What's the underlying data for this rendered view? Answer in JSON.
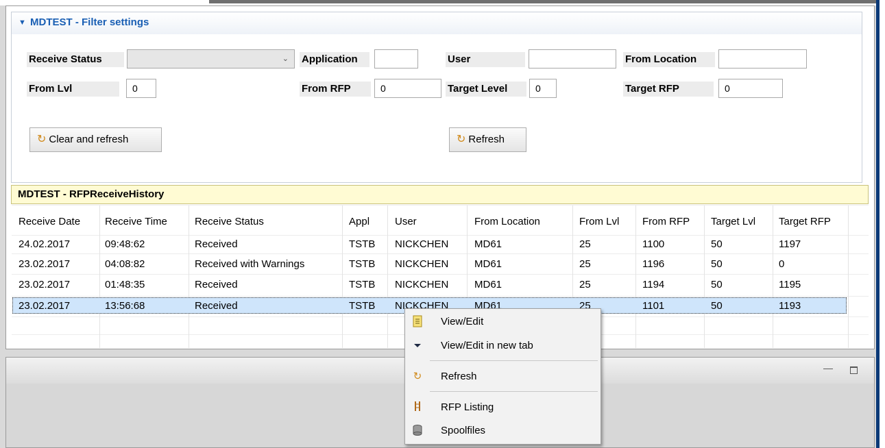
{
  "filter": {
    "title": "MDTEST - Filter settings",
    "fields": {
      "receive_status": {
        "label": "Receive Status",
        "value": ""
      },
      "application": {
        "label": "Application",
        "value": ""
      },
      "user": {
        "label": "User",
        "value": ""
      },
      "from_location": {
        "label": "From Location",
        "value": ""
      },
      "from_lvl": {
        "label": "From Lvl",
        "value": "0"
      },
      "from_rfp": {
        "label": "From RFP",
        "value": "0"
      },
      "target_level": {
        "label": "Target Level",
        "value": "0"
      },
      "target_rfp": {
        "label": "Target RFP",
        "value": "0"
      }
    },
    "clear_refresh_label": "Clear and refresh",
    "refresh_label": "Refresh"
  },
  "history": {
    "title": "MDTEST - RFPReceiveHistory",
    "columns": [
      "Receive Date",
      "Receive Time",
      "Receive Status",
      "Appl",
      "User",
      "From Location",
      "From Lvl",
      "From RFP",
      "Target Lvl",
      "Target RFP"
    ],
    "rows": [
      [
        "24.02.2017",
        "09:48:62",
        "Received",
        "TSTB",
        "NICKCHEN",
        "MD61",
        "25",
        "1100",
        "50",
        "1197"
      ],
      [
        "23.02.2017",
        "04:08:82",
        "Received with Warnings",
        "TSTB",
        "NICKCHEN",
        "MD61",
        "25",
        "1196",
        "50",
        "0"
      ],
      [
        "23.02.2017",
        "01:48:35",
        "Received",
        "TSTB",
        "NICKCHEN",
        "MD61",
        "25",
        "1194",
        "50",
        "1195"
      ],
      [
        "23.02.2017",
        "13:56:68",
        "Received",
        "TSTB",
        "NICKCHEN",
        "MD61",
        "25",
        "1101",
        "50",
        "1193"
      ]
    ],
    "selected_row": 3
  },
  "context_menu": {
    "items": [
      {
        "label": "View/Edit",
        "icon": "document-icon"
      },
      {
        "label": "View/Edit in new tab",
        "icon": "dropdown-arrow-icon"
      },
      {
        "label": "Refresh",
        "icon": "refresh-icon"
      },
      {
        "label": "RFP Listing",
        "icon": "listing-icon"
      },
      {
        "label": "Spoolfiles",
        "icon": "database-icon"
      }
    ]
  },
  "colors": {
    "accent": "#1a5fb4",
    "table_title_bg": "#fffbd3",
    "selection_bg": "#cfe5fb",
    "refresh_icon": "#d08a1c"
  }
}
